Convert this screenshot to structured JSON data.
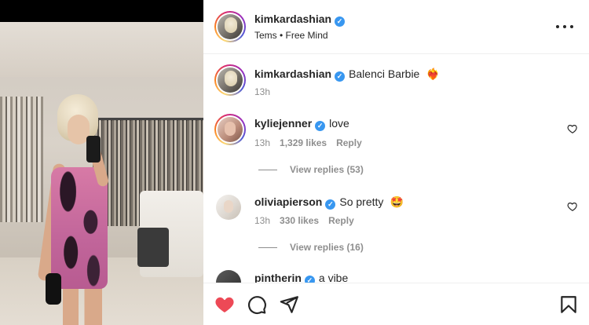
{
  "post": {
    "author": "kimkardashian",
    "audio_text": "Tems • Free Mind",
    "caption_text": "Balenci Barbie",
    "caption_emoji": "❤️‍🔥",
    "caption_time": "13h"
  },
  "comments": [
    {
      "username": "kyliejenner",
      "text": "love",
      "time": "13h",
      "likes": "1,329 likes",
      "reply": "Reply",
      "view_replies": "View replies (53)"
    },
    {
      "username": "oliviapierson",
      "text": "So pretty",
      "emoji": "🤩",
      "time": "13h",
      "likes": "330 likes",
      "reply": "Reply",
      "view_replies": "View replies (16)"
    },
    {
      "username": "pintherin",
      "text": "a vibe"
    }
  ],
  "icons": {
    "like": "heart-filled-icon",
    "comment": "comment-icon",
    "share": "share-icon",
    "save": "bookmark-icon",
    "more": "more-options-icon"
  },
  "colors": {
    "like": "#ed4956",
    "verified": "#3897f0",
    "muted": "#8e8e8e"
  }
}
